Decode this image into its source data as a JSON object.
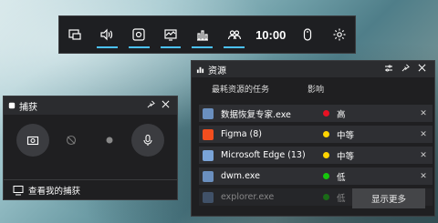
{
  "gamebar": {
    "time": "10:00",
    "buttons": [
      {
        "icon": "widget-menu-icon",
        "active": false
      },
      {
        "icon": "audio-icon",
        "active": true
      },
      {
        "icon": "capture-icon",
        "active": true
      },
      {
        "icon": "performance-icon",
        "active": true
      },
      {
        "icon": "resources-icon",
        "active": true
      },
      {
        "icon": "social-icon",
        "active": true
      }
    ]
  },
  "capture": {
    "title": "捕获",
    "footer": "查看我的捕获"
  },
  "resource": {
    "title": "资源",
    "tabs": [
      "最耗资源的任务",
      "影响"
    ],
    "rows": [
      {
        "name": "数据恢复专家.exe",
        "level": "高",
        "color": "#e81123",
        "icon_color": "#6a8fbf"
      },
      {
        "name": "Figma (8)",
        "level": "中等",
        "color": "#ffd400",
        "icon_color": "#f24e1e"
      },
      {
        "name": "Microsoft Edge (13)",
        "level": "中等",
        "color": "#ffd400",
        "icon_color": "#7aa4d8"
      },
      {
        "name": "dwm.exe",
        "level": "低",
        "color": "#16c60c",
        "icon_color": "#6a8fbf"
      },
      {
        "name": "explorer.exe",
        "level": "低",
        "color": "#16c60c",
        "icon_color": "#6a8fbf"
      }
    ],
    "more_button": "显示更多"
  }
}
